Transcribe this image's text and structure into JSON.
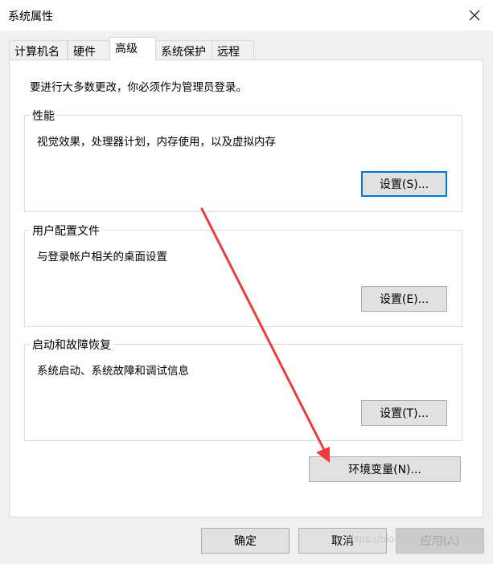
{
  "window": {
    "title": "系统属性"
  },
  "tabs": [
    {
      "label": "计算机名"
    },
    {
      "label": "硬件"
    },
    {
      "label": "高级",
      "active": true
    },
    {
      "label": "系统保护"
    },
    {
      "label": "远程"
    }
  ],
  "admin_note": "要进行大多数更改，你必须作为管理员登录。",
  "groups": {
    "performance": {
      "title": "性能",
      "desc": "视觉效果，处理器计划，内存使用，以及虚拟内存",
      "button": "设置(S)..."
    },
    "profiles": {
      "title": "用户配置文件",
      "desc": "与登录帐户相关的桌面设置",
      "button": "设置(E)..."
    },
    "startup": {
      "title": "启动和故障恢复",
      "desc": "系统启动、系统故障和调试信息",
      "button": "设置(T)..."
    }
  },
  "env_button": "环境变量(N)...",
  "footer": {
    "ok": "确定",
    "cancel": "取消",
    "apply": "应用(A)"
  },
  "watermark": "https://blog.csdn.net/aaxzsuj",
  "colors": {
    "accent": "#0078d7",
    "arrow": "#ee3b3b"
  }
}
